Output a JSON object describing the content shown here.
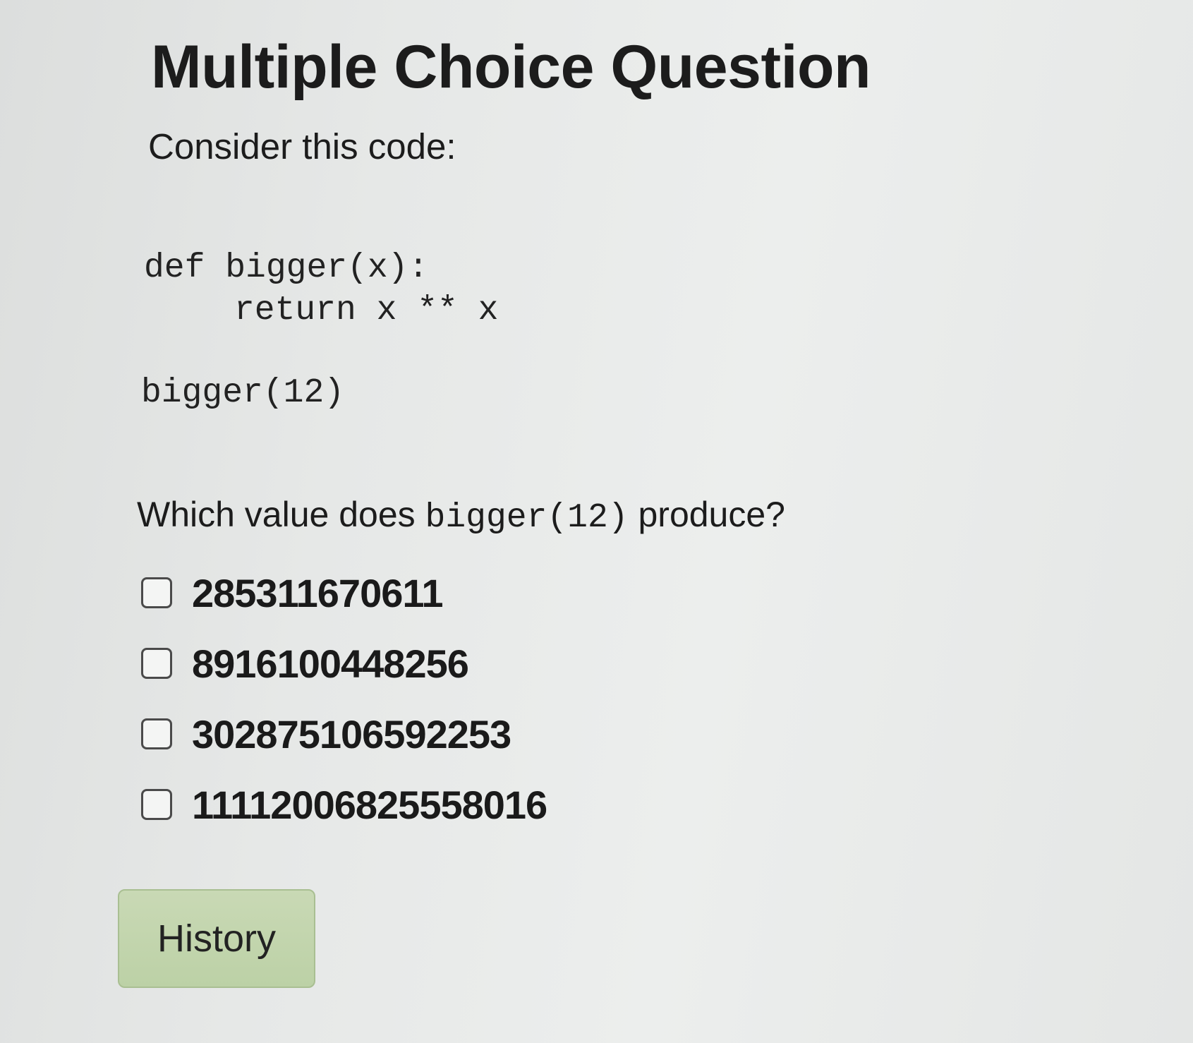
{
  "title": "Multiple Choice Question",
  "intro": "Consider this code:",
  "code": {
    "lines": [
      "def bigger(x):",
      "return x ** x"
    ],
    "call": "bigger(12)"
  },
  "question": {
    "prefix": "Which value does ",
    "code": "bigger(12)",
    "suffix": " produce?"
  },
  "options": [
    {
      "label": "285311670611",
      "checked": false
    },
    {
      "label": "8916100448256",
      "checked": false
    },
    {
      "label": "302875106592253",
      "checked": false
    },
    {
      "label": "11112006825558016",
      "checked": false
    }
  ],
  "history_button": "History"
}
